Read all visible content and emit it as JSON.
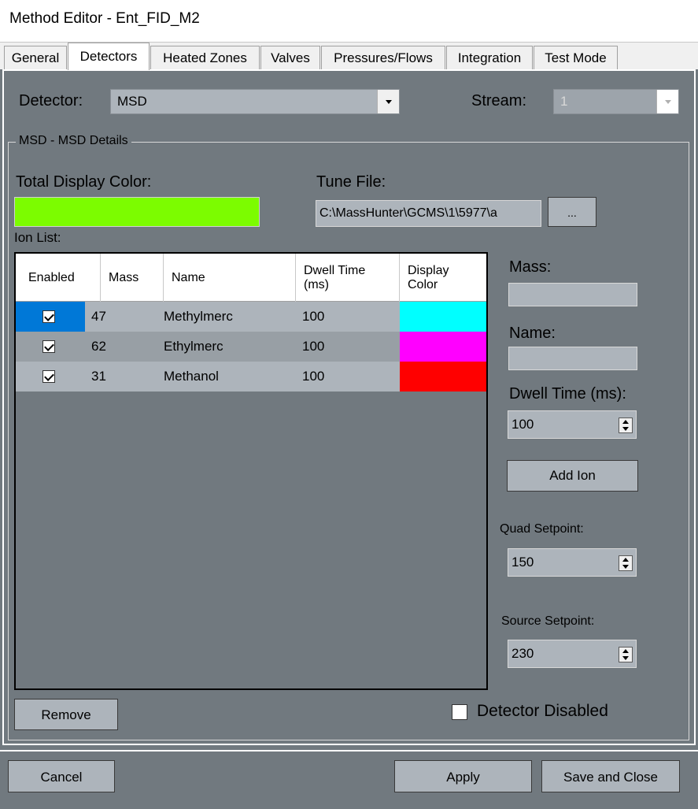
{
  "window": {
    "title": "Method Editor - Ent_FID_M2"
  },
  "tabs": [
    {
      "label": "General"
    },
    {
      "label": "Detectors",
      "active": true
    },
    {
      "label": "Heated Zones"
    },
    {
      "label": "Valves"
    },
    {
      "label": "Pressures/Flows"
    },
    {
      "label": "Integration"
    },
    {
      "label": "Test Mode"
    }
  ],
  "detector": {
    "label": "Detector:",
    "value": "MSD"
  },
  "stream": {
    "label": "Stream:",
    "value": "1"
  },
  "group": {
    "title": "MSD - MSD Details"
  },
  "total_display_color": {
    "label": "Total Display Color:",
    "color": "#7cfc00"
  },
  "tune_file": {
    "label": "Tune File:",
    "value": "C:\\MassHunter\\GCMS\\1\\5977\\a",
    "browse_label": "..."
  },
  "ion_list": {
    "label": "Ion List:",
    "columns": [
      "Enabled",
      "Mass",
      "Name",
      "Dwell Time (ms)",
      "Display Color"
    ],
    "rows": [
      {
        "enabled": true,
        "mass": "47",
        "name": "Methylmerc",
        "dwell": "100",
        "color": "#00ffff",
        "selected": true
      },
      {
        "enabled": true,
        "mass": "62",
        "name": "Ethylmerc",
        "dwell": "100",
        "color": "#ff00ff"
      },
      {
        "enabled": true,
        "mass": "31",
        "name": "Methanol",
        "dwell": "100",
        "color": "#ff0000"
      }
    ]
  },
  "side": {
    "mass_label": "Mass:",
    "mass_value": "",
    "name_label": "Name:",
    "name_value": "",
    "dwell_label": "Dwell Time (ms):",
    "dwell_value": "100",
    "add_ion": "Add Ion",
    "quad_label": "Quad Setpoint:",
    "quad_value": "150",
    "source_label": "Source Setpoint:",
    "source_value": "230"
  },
  "remove_label": "Remove",
  "detector_disabled": {
    "label": "Detector Disabled",
    "checked": false
  },
  "footer": {
    "cancel": "Cancel",
    "apply": "Apply",
    "save_close": "Save and Close"
  },
  "colors": {
    "panel_bg": "#71797f",
    "selected_row": "#0078d7",
    "field_bg": "#adb4bb"
  }
}
